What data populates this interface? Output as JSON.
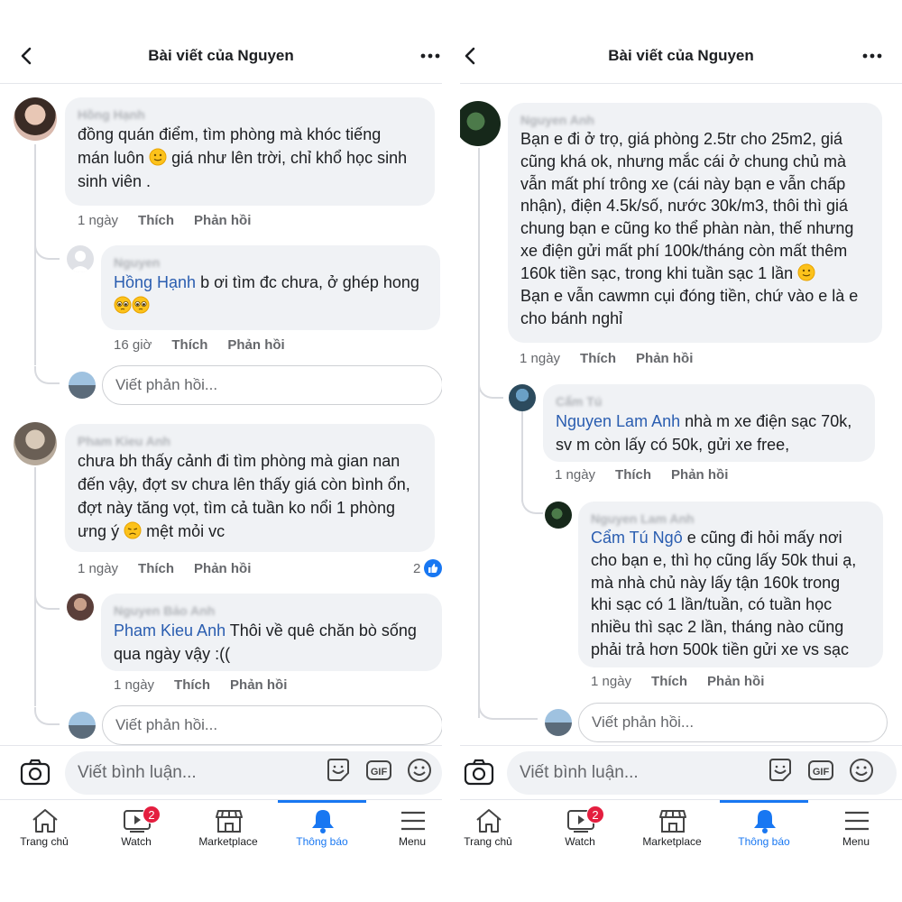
{
  "left": {
    "header": {
      "title": "Bài viết của Nguyen"
    },
    "comments": [
      {
        "name": "Hồng Hạnh",
        "text": "đồng quán điểm, tìm phòng mà khóc tiếng",
        "text2": "mán luôn",
        "text3": "giá như lên trời, chỉ khổ học sinh",
        "text4": "sinh viên .",
        "time": "1 ngày",
        "like": "Thích",
        "reply": "Phản hồi"
      },
      {
        "name": "Nguyen",
        "mention": "Hồng Hạnh",
        "text": "b ơi tìm đc chưa, ở ghép hong",
        "time": "16 giờ",
        "like": "Thích",
        "reply": "Phản hồi"
      },
      {
        "name": "Pham Kieu Anh",
        "text": "chưa bh thấy cảnh đi tìm phòng mà gian nan",
        "text2": "đến vậy, đợt sv chưa lên thấy giá còn bình ổn,",
        "text3": "đợt này tăng vọt, tìm cả tuần ko nổi 1 phòng",
        "text4": "ưng ý",
        "text5": "mệt mỏi vc",
        "time": "1 ngày",
        "like": "Thích",
        "reply": "Phản hồi",
        "like_count": "2"
      },
      {
        "name": "Nguyen Bảo Anh",
        "mention": "Pham Kieu Anh",
        "text": " Thôi về quê chăn bò sống",
        "text2": "qua ngày vậy :((",
        "time": "1 ngày",
        "like": "Thích",
        "reply": "Phản hồi"
      }
    ],
    "reply_placeholder": "Viết phản hồi...",
    "comment_placeholder": "Viết bình luận...",
    "nav": [
      {
        "label": "Trang chủ",
        "icon": "home-icon"
      },
      {
        "label": "Watch",
        "icon": "watch-icon",
        "badge": "2"
      },
      {
        "label": "Marketplace",
        "icon": "marketplace-icon"
      },
      {
        "label": "Thông báo",
        "icon": "bell-icon",
        "active": true
      },
      {
        "label": "Menu",
        "icon": "menu-icon"
      }
    ]
  },
  "right": {
    "header": {
      "title": "Bài viết của Nguyen"
    },
    "comments": [
      {
        "name": "Nguyen Anh",
        "lines": [
          "Bạn e đi ở trọ, giá phòng 2.5tr cho 25m2, giá",
          "cũng khá ok, nhưng mắc cái ở chung chủ mà",
          "vẫn mất phí trông xe (cái này bạn e vẫn chấp",
          "nhận), điện 4.5k/số, nước 30k/m3, thôi thì giá",
          "chung bạn e cũng ko thể phàn nàn, thế nhưng",
          "xe điện gửi mất phí 100k/tháng còn mất thêm",
          "160k tiền sạc, trong khi tuần sạc 1 lần",
          "Bạn e vẫn cawmn cụi đóng tiền, chứ vào e là e",
          "cho bánh nghỉ"
        ],
        "time": "1 ngày",
        "like": "Thích",
        "reply": "Phản hồi"
      },
      {
        "name": "Cẩm Tú",
        "mention": "Nguyen Lam Anh",
        "text": " nhà m xe điện sạc 70k,",
        "text2": "sv m còn lấy có 50k, gửi xe free,",
        "time": "1 ngày",
        "like": "Thích",
        "reply": "Phản hồi"
      },
      {
        "name": "Nguyen Lam Anh",
        "mention": "Cẩm Tú Ngô",
        "text": " e cũng đi hỏi mấy nơi",
        "lines": [
          "cho bạn e, thì họ cũng lấy 50k thui ạ,",
          "mà nhà chủ này lấy tận 160k trong",
          "khi sạc có 1 lần/tuần, có tuần học",
          "nhiều thì sạc 2 lần, tháng nào cũng",
          "phải trả hơn 500k tiền gửi xe vs sạc"
        ],
        "time": "1 ngày",
        "like": "Thích",
        "reply": "Phản hồi"
      }
    ],
    "reply_placeholder": "Viết phản hồi...",
    "comment_placeholder": "Viết bình luận...",
    "nav": [
      {
        "label": "Trang chủ",
        "icon": "home-icon"
      },
      {
        "label": "Watch",
        "icon": "watch-icon",
        "badge": "2"
      },
      {
        "label": "Marketplace",
        "icon": "marketplace-icon"
      },
      {
        "label": "Thông báo",
        "icon": "bell-icon",
        "active": true
      },
      {
        "label": "Menu",
        "icon": "menu-icon"
      }
    ]
  },
  "colors": {
    "mention": "#2a5db0",
    "active": "#1877f2",
    "badge": "#e41e3f",
    "bubble": "#f0f2f5"
  }
}
